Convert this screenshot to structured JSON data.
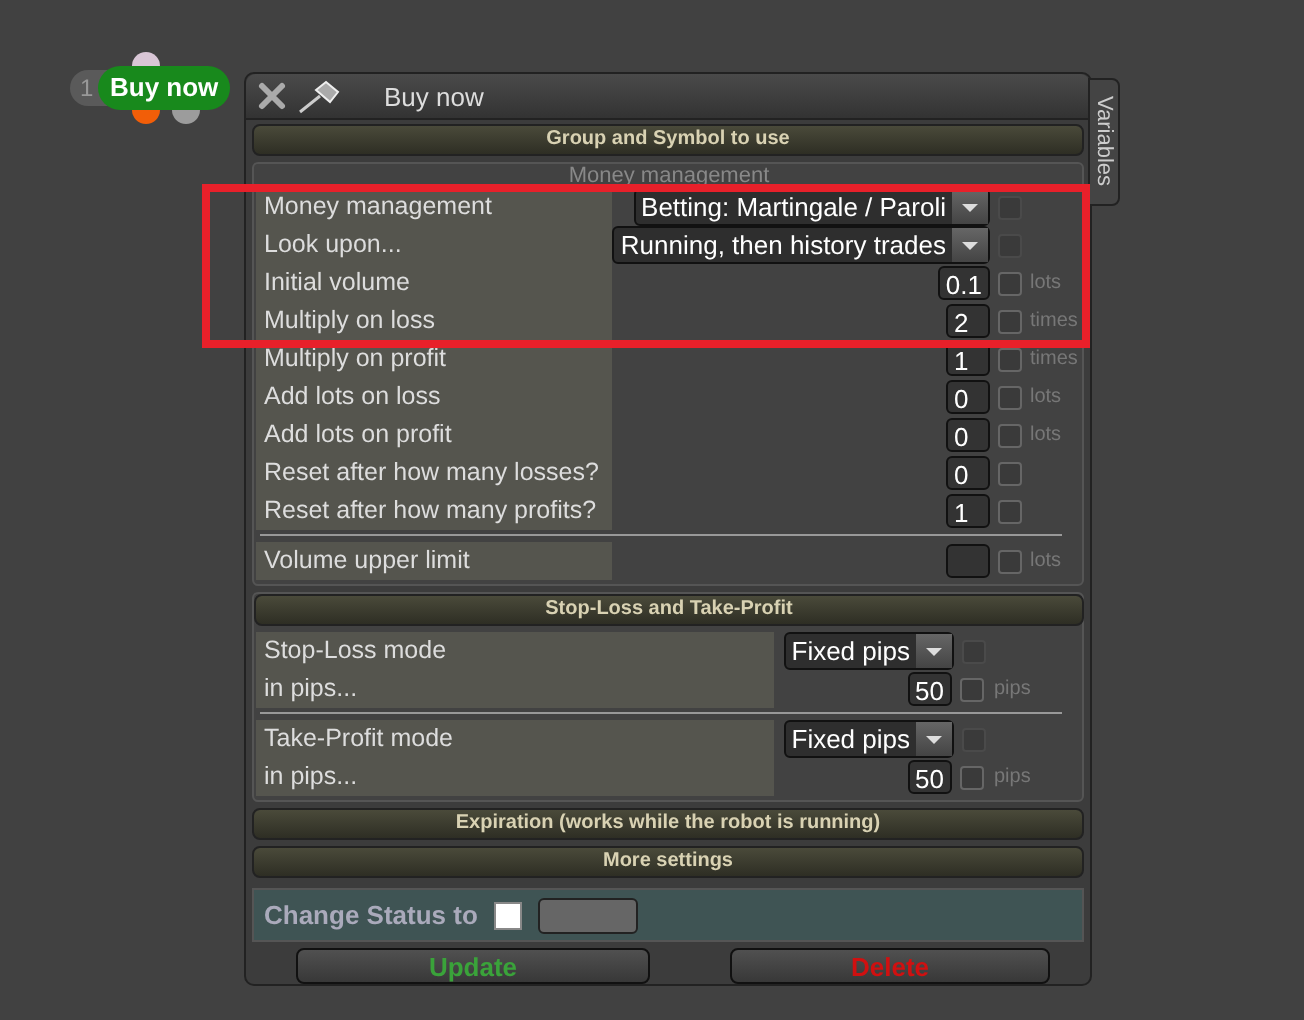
{
  "node": {
    "index": "1",
    "label": "Buy now"
  },
  "window": {
    "title": "Buy now",
    "side_tab": "Variables"
  },
  "group_header": "Group and Symbol to use",
  "money_management": {
    "title": "Money management",
    "rows": [
      {
        "kind": "select",
        "label": "Money management",
        "value": "Betting: Martingale / Paroli",
        "checked": false
      },
      {
        "kind": "select",
        "label": "Look upon...",
        "value": "Running, then history trades",
        "checked": false
      },
      {
        "kind": "number",
        "label": "Initial volume",
        "value": "0.1",
        "unit": "lots",
        "checked": false
      },
      {
        "kind": "number",
        "label": "Multiply on loss",
        "value": "2",
        "unit": "times",
        "checked": false
      },
      {
        "kind": "number",
        "label": "Multiply on profit",
        "value": "1",
        "unit": "times",
        "checked": false
      },
      {
        "kind": "number",
        "label": "Add lots on loss",
        "value": "0",
        "unit": "lots",
        "checked": false
      },
      {
        "kind": "number",
        "label": "Add lots on profit",
        "value": "0",
        "unit": "lots",
        "checked": false
      },
      {
        "kind": "number",
        "label": "Reset after how many losses?",
        "value": "0",
        "checked": false
      },
      {
        "kind": "number",
        "label": "Reset after how many profits?",
        "value": "1",
        "checked": false
      }
    ],
    "limit_rows": [
      {
        "kind": "number",
        "label": "Volume upper limit",
        "unit": "lots",
        "checked": false
      }
    ]
  },
  "stop_take": {
    "title": "Stop-Loss and Take-Profit",
    "groups": [
      [
        {
          "kind": "select",
          "label": "Stop-Loss mode",
          "value": "Fixed pips",
          "checked": false
        },
        {
          "kind": "number",
          "label": "in pips...",
          "value": "50",
          "unit": "pips",
          "checked": false
        }
      ],
      [
        {
          "kind": "select",
          "label": "Take-Profit mode",
          "value": "Fixed pips",
          "checked": false
        },
        {
          "kind": "number",
          "label": "in pips...",
          "value": "50",
          "unit": "pips",
          "checked": false
        }
      ]
    ]
  },
  "collapsed_sections": [
    "Expiration (works while the robot is running)",
    "More settings"
  ],
  "status": {
    "label": "Change Status to",
    "checked": false
  },
  "buttons": [
    {
      "label": "Update",
      "kind": "update"
    },
    {
      "label": "Delete",
      "kind": "delete"
    }
  ]
}
